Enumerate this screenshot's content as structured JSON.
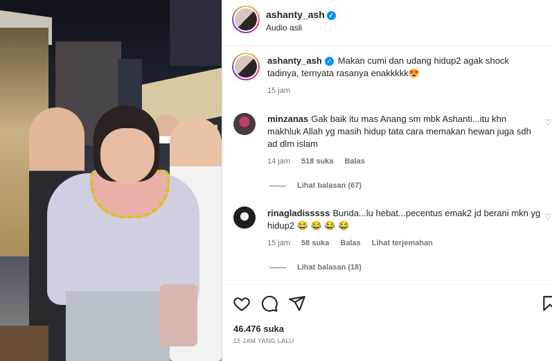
{
  "post": {
    "username": "ashanty_ash",
    "audio": "Audio asli",
    "caption": "Makan cumi dan udang hidup2 agak shock tadinya, ternyata rasanya enakkkkk😍",
    "caption_time": "15 jam"
  },
  "comments": [
    {
      "username": "minzanas",
      "text": "Gak baik itu mas Anang sm mbk Ashanti...itu khn makhluk Allah yg masih hidup tata cara memakan hewan juga sdh ad dlm islam",
      "time": "14 jam",
      "likes": "518 suka",
      "reply": "Balas",
      "view_replies": "Lihat balasan (67)"
    },
    {
      "username": "rinagladisssss",
      "text": "Bunda...lu hebat...pecentus emak2 jd berani mkn yg hidup2 😂 😂 😂 😂",
      "time": "15 jam",
      "likes": "58 suka",
      "reply": "Balas",
      "translate": "Lihat terjemahan",
      "view_replies": "Lihat balasan (18)"
    }
  ],
  "footer": {
    "likes": "46.476 suka",
    "time": "15 JAM YANG LALU"
  },
  "icons": {
    "like": "heart-icon",
    "comment": "comment-icon",
    "share": "share-icon",
    "save": "bookmark-icon",
    "verified": "verified-icon"
  },
  "colors": {
    "verified": "#0095f6",
    "secondary_text": "#737373",
    "primary_text": "#262626"
  }
}
